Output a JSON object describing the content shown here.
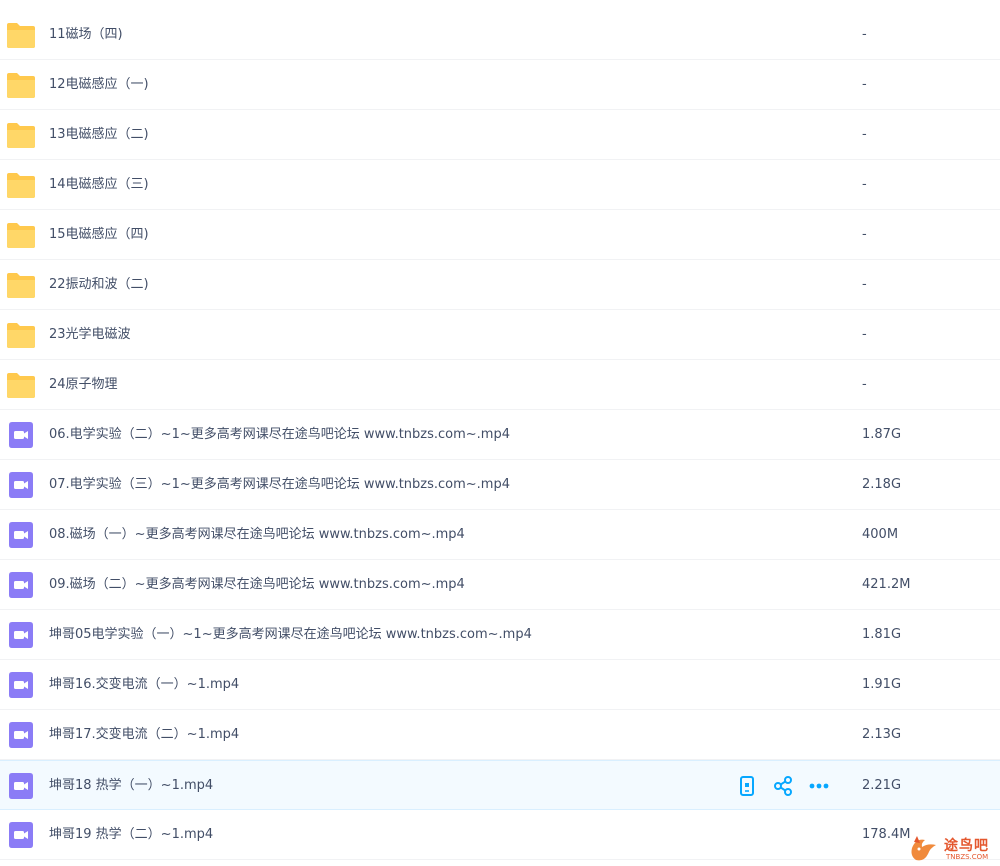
{
  "colors": {
    "folder": "#ffc94d",
    "video": "#8b7cf6",
    "accent": "#06a7ff",
    "text": "#424e67",
    "watermark": "#e4572e"
  },
  "files": [
    {
      "type": "folder",
      "name": "11磁场（四)",
      "size": "-"
    },
    {
      "type": "folder",
      "name": "12电磁感应（一)",
      "size": "-"
    },
    {
      "type": "folder",
      "name": "13电磁感应（二)",
      "size": "-"
    },
    {
      "type": "folder",
      "name": "14电磁感应（三)",
      "size": "-"
    },
    {
      "type": "folder",
      "name": "15电磁感应（四)",
      "size": "-"
    },
    {
      "type": "folder",
      "name": "22振动和波（二)",
      "size": "-"
    },
    {
      "type": "folder",
      "name": "23光学电磁波",
      "size": "-"
    },
    {
      "type": "folder",
      "name": "24原子物理",
      "size": "-"
    },
    {
      "type": "video",
      "name": "06.电学实验（二）~1~更多高考网课尽在途鸟吧论坛 www.tnbzs.com~.mp4",
      "size": "1.87G"
    },
    {
      "type": "video",
      "name": "07.电学实验（三）~1~更多高考网课尽在途鸟吧论坛 www.tnbzs.com~.mp4",
      "size": "2.18G"
    },
    {
      "type": "video",
      "name": "08.磁场（一）~更多高考网课尽在途鸟吧论坛 www.tnbzs.com~.mp4",
      "size": "400M"
    },
    {
      "type": "video",
      "name": "09.磁场（二）~更多高考网课尽在途鸟吧论坛 www.tnbzs.com~.mp4",
      "size": "421.2M"
    },
    {
      "type": "video",
      "name": "坤哥05电学实验（一）~1~更多高考网课尽在途鸟吧论坛 www.tnbzs.com~.mp4",
      "size": "1.81G"
    },
    {
      "type": "video",
      "name": "坤哥16.交变电流（一）~1.mp4",
      "size": "1.91G"
    },
    {
      "type": "video",
      "name": "坤哥17.交变电流（二）~1.mp4",
      "size": "2.13G"
    },
    {
      "type": "video",
      "name": "坤哥18 热学（一）~1.mp4",
      "size": "2.21G"
    },
    {
      "type": "video",
      "name": "坤哥19 热学（二）~1.mp4",
      "size": "178.4M"
    }
  ],
  "row_actions": [
    "phone-icon",
    "share-icon",
    "more-icon"
  ],
  "watermark": {
    "text": "途鸟吧",
    "sub": "TNBZS.COM"
  }
}
